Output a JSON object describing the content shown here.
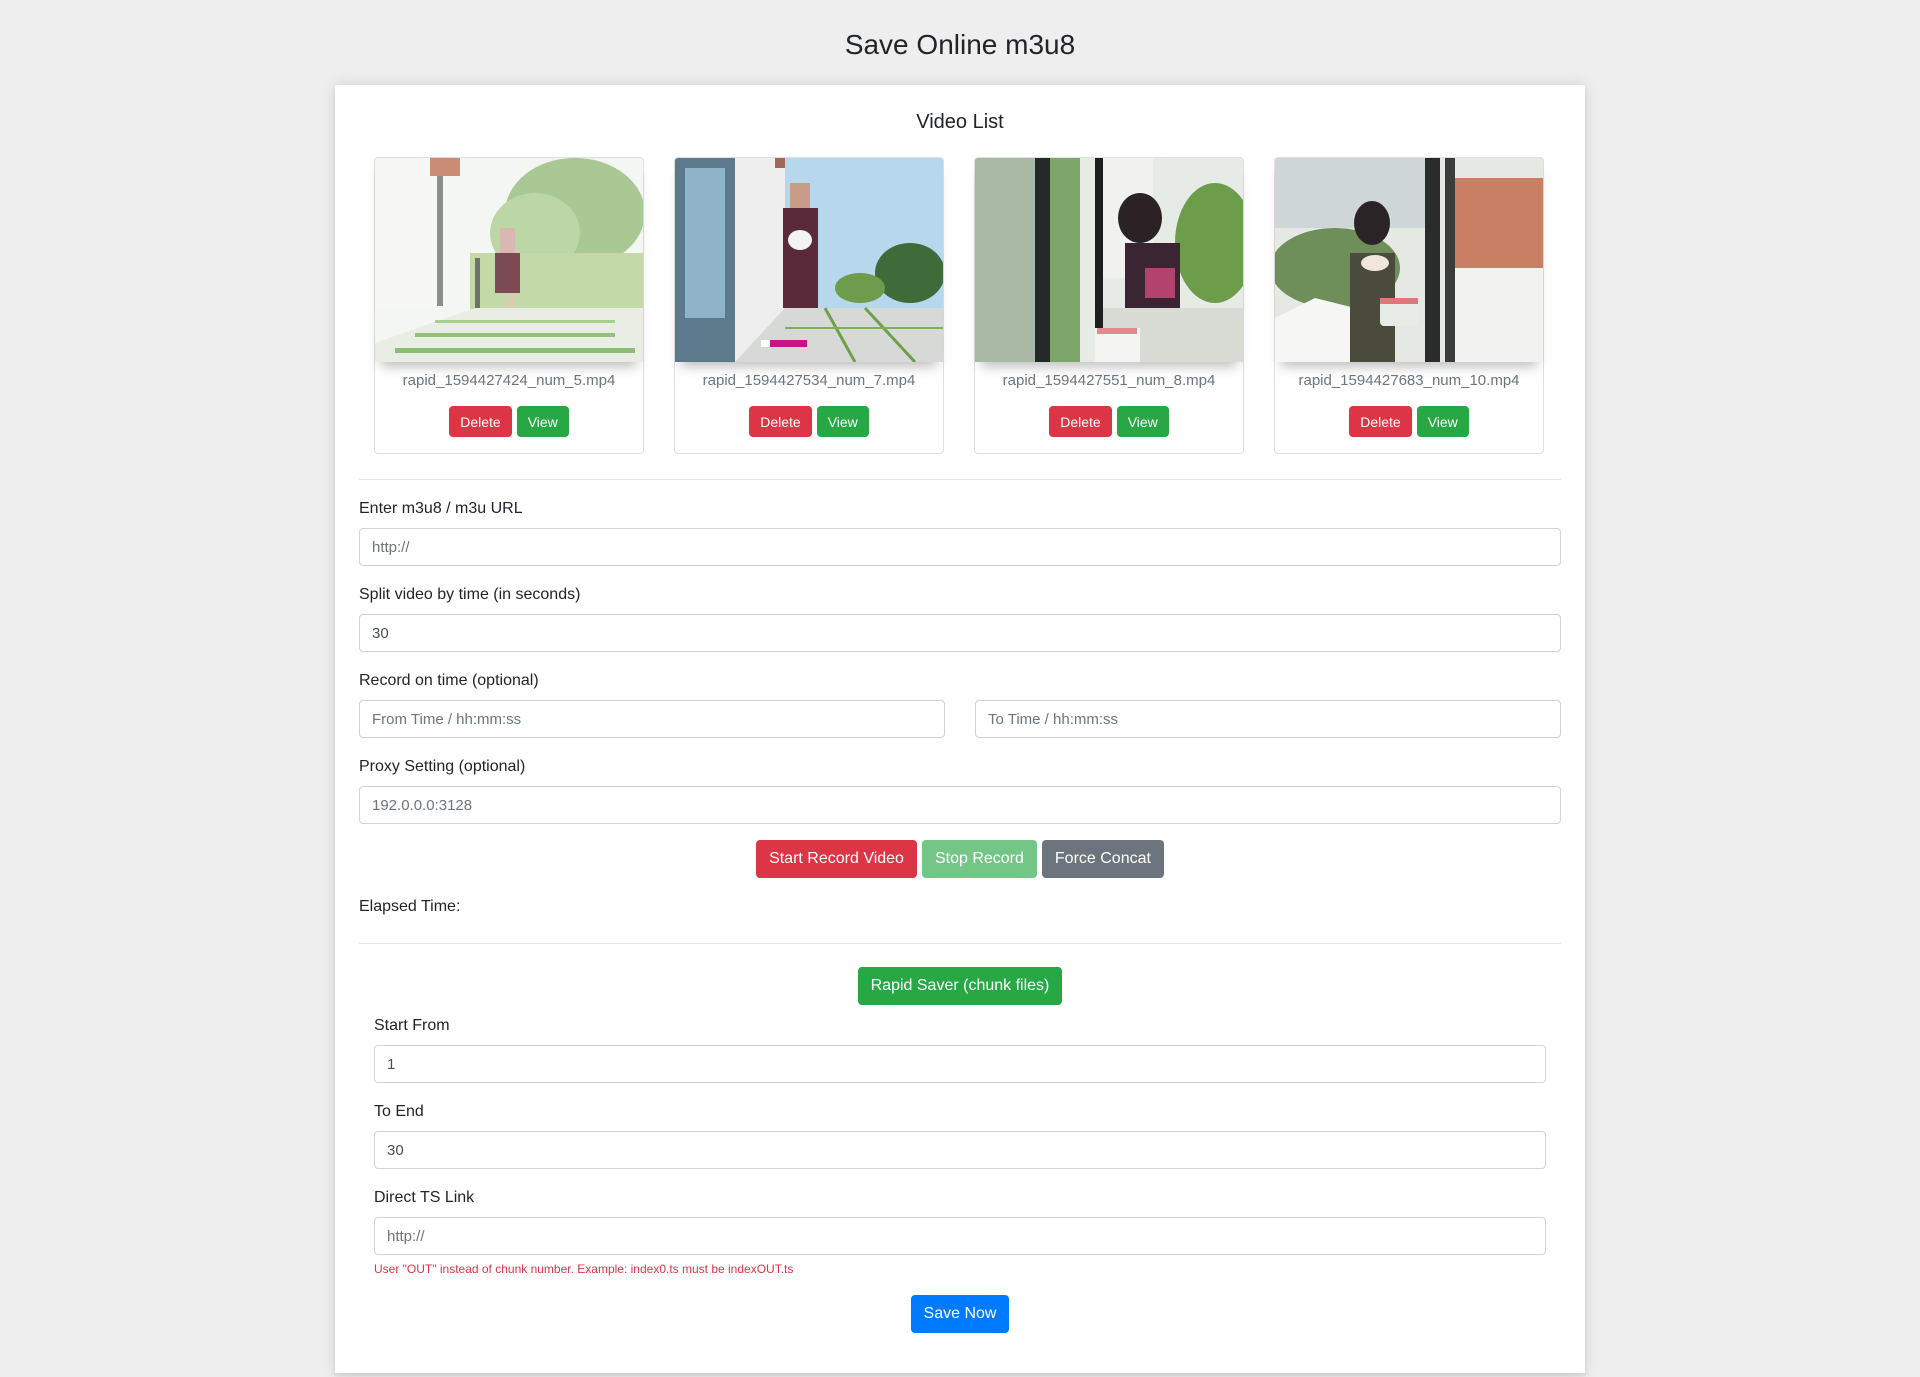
{
  "page": {
    "title": "Save Online m3u8"
  },
  "video_list": {
    "title": "Video List",
    "videos": [
      {
        "filename": "rapid_1594427424_num_5.mp4",
        "thumbnail": "outdoor-garden-woman-standing",
        "delete_label": "Delete",
        "view_label": "View"
      },
      {
        "filename": "rapid_1594427534_num_7.mp4",
        "thumbnail": "woman-holding-bowl-by-house",
        "delete_label": "Delete",
        "view_label": "View"
      },
      {
        "filename": "rapid_1594427551_num_8.mp4",
        "thumbnail": "woman-at-glass-door",
        "delete_label": "Delete",
        "view_label": "View"
      },
      {
        "filename": "rapid_1594427683_num_10.mp4",
        "thumbnail": "woman-laughing-patio",
        "delete_label": "Delete",
        "view_label": "View"
      }
    ]
  },
  "record_form": {
    "url_label": "Enter m3u8 / m3u URL",
    "url_placeholder": "http://",
    "url_value": "",
    "split_label": "Split video by time (in seconds)",
    "split_value": "30",
    "record_time_label": "Record on time (optional)",
    "from_time_placeholder": "From Time / hh:mm:ss",
    "to_time_placeholder": "To Time / hh:mm:ss",
    "proxy_label": "Proxy Setting (optional)",
    "proxy_placeholder": "192.0.0.0:3128",
    "start_button": "Start Record Video",
    "stop_button": "Stop Record",
    "concat_button": "Force Concat",
    "elapsed_label": "Elapsed Time:",
    "elapsed_value": ""
  },
  "rapid_saver": {
    "button": "Rapid Saver (chunk files)",
    "start_label": "Start From",
    "start_value": "1",
    "end_label": "To End",
    "end_value": "30",
    "ts_label": "Direct TS Link",
    "ts_placeholder": "http://",
    "help_text": "User \"OUT\" instead of chunk number. Example: index0.ts must be indexOUT.ts",
    "save_button": "Save Now"
  },
  "colors": {
    "danger": "#dc3545",
    "success": "#28a745",
    "success_disabled": "#74c687",
    "secondary": "#6c757d",
    "primary": "#007bff",
    "background": "#eeeeee"
  }
}
